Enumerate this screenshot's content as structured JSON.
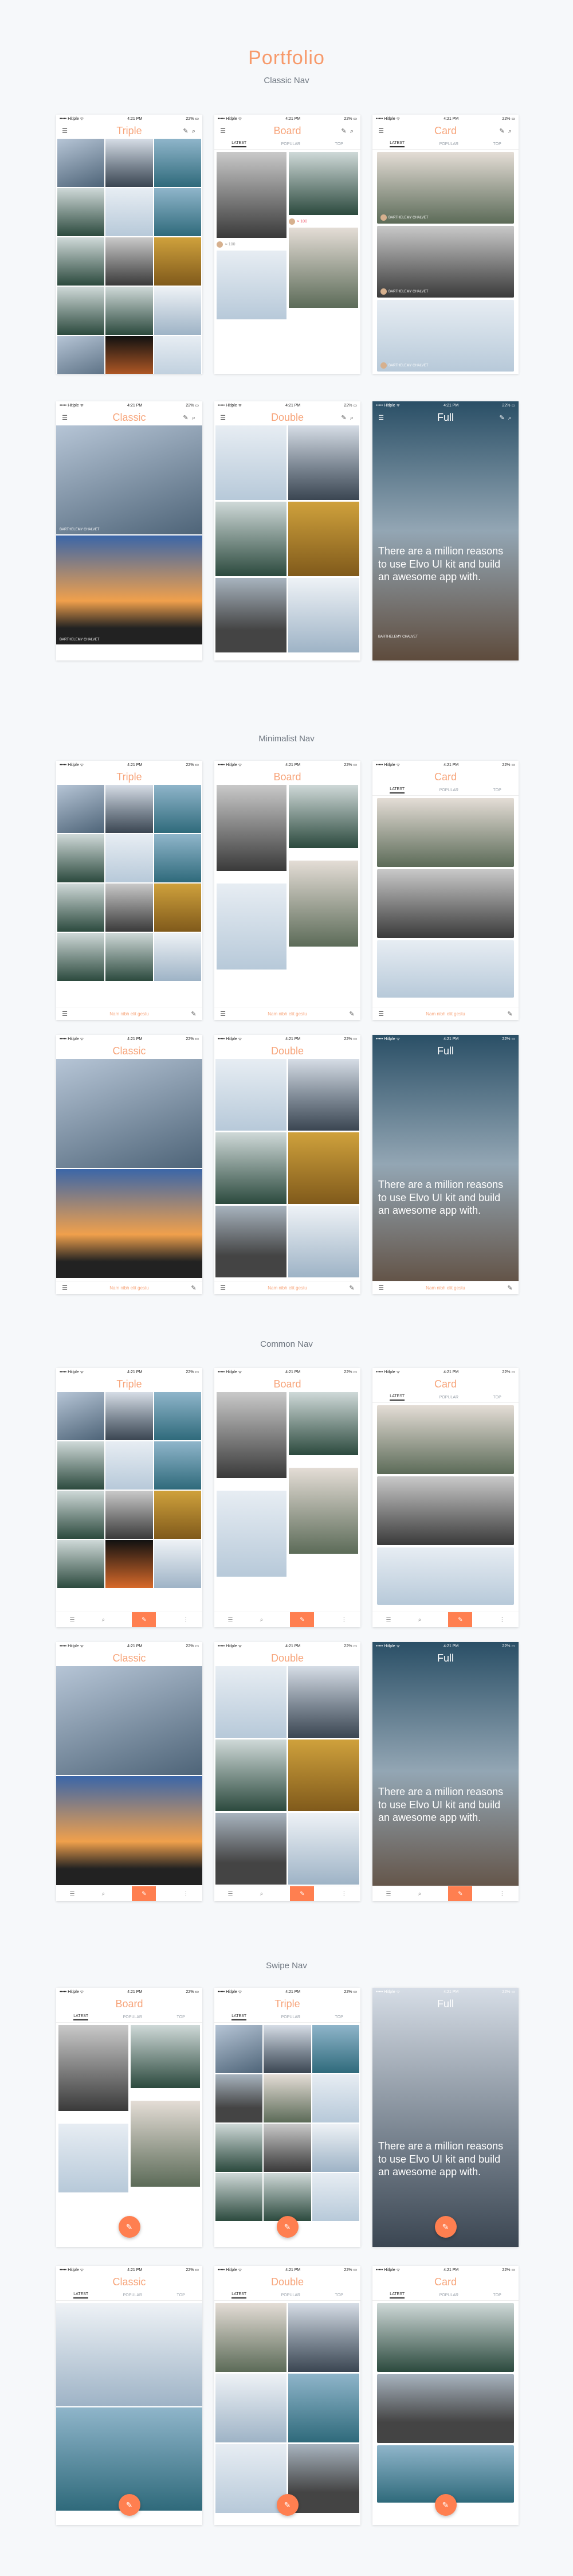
{
  "title": "Portfolio",
  "sections": {
    "classic": "Classic Nav",
    "minimalist": "Minimalist Nav",
    "common": "Common Nav",
    "swipe": "Swipe Nav"
  },
  "status": {
    "carrier": "••••• Hitlple ᯤ",
    "time": "4:21 PM",
    "battery": "22% ▭"
  },
  "screens": {
    "triple": "Triple",
    "board": "Board",
    "card": "Card",
    "classic": "Classic",
    "double": "Double",
    "full": "Full"
  },
  "tabs": [
    "LATEST",
    "POPULAR",
    "TOP"
  ],
  "full_text": "There are a million reasons to use Elvo UI kit and build an awesome app with.",
  "author": {
    "name": "BARTHELEMY CHALVET",
    "sub": "Singer"
  },
  "min_nav": {
    "center": "Nam nibh elit gestu"
  },
  "likes": "≈ 100",
  "icons": {
    "menu": "☰",
    "search": "⌕",
    "edit": "✎",
    "more": "⋮"
  },
  "colors": {
    "accent": "#ff7f50",
    "title": "#f79a6b"
  }
}
